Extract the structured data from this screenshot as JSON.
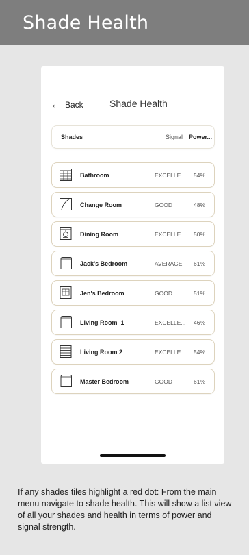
{
  "banner": {
    "title": "Shade Health"
  },
  "app": {
    "back_label": "Back",
    "title": "Shade Health",
    "header": {
      "shades": "Shades",
      "signal": "Signal",
      "power": "Power..."
    },
    "rows": [
      {
        "name": "Bathroom",
        "signal": "EXCELLE...",
        "power": "54%",
        "icon": "shade-grid-icon"
      },
      {
        "name": "Change Room",
        "signal": "GOOD",
        "power": "48%",
        "icon": "curtain-icon"
      },
      {
        "name": "Dining Room",
        "signal": "EXCELLE...",
        "power": "50%",
        "icon": "roman-shade-icon"
      },
      {
        "name": "Jack's Bedroom",
        "signal": "AVERAGE",
        "power": "61%",
        "icon": "roller-shade-icon"
      },
      {
        "name": "Jen's Bedroom",
        "signal": "GOOD",
        "power": "51%",
        "icon": "window-shade-icon"
      },
      {
        "name": "Living Room  1",
        "signal": "EXCELLE...",
        "power": "46%",
        "icon": "roller-shade-icon"
      },
      {
        "name": "Living Room 2",
        "signal": "EXCELLE...",
        "power": "54%",
        "icon": "venetian-blind-icon"
      },
      {
        "name": "Master Bedroom",
        "signal": "GOOD",
        "power": "61%",
        "icon": "roller-shade-icon"
      }
    ]
  },
  "caption": "If any shades tiles highlight a red dot: From the main menu navigate to shade health. This will show a list view of all your shades and health in terms of power and signal strength."
}
